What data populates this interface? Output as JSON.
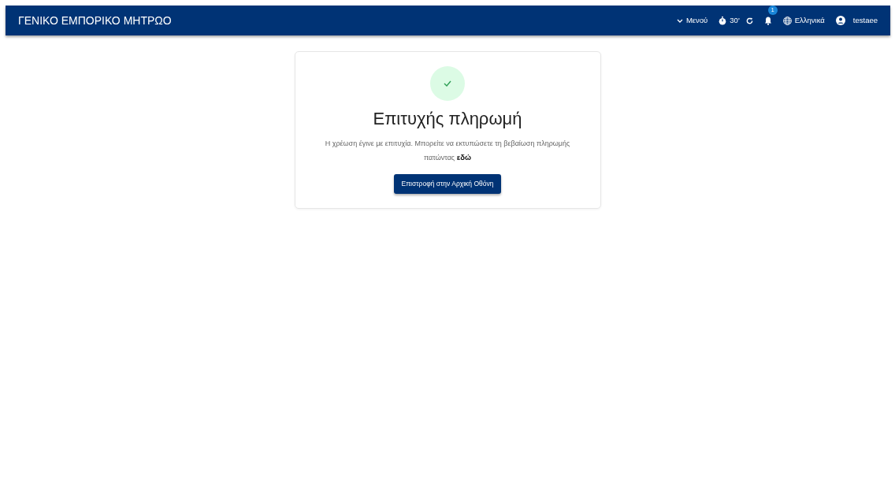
{
  "navbar": {
    "brand": "ΓΕΝΙΚΟ ΕΜΠΟΡΙΚΟ ΜΗΤΡΩΟ",
    "menu": "Μενού",
    "timer": "30'",
    "notifications": "1",
    "language": "Ελληνικά",
    "user": "testaee"
  },
  "card": {
    "title": "Επιτυχής πληρωμή",
    "message": "Η χρέωση έγινε με επιτυχία. Μπορείτε να εκτυπώσετε τη βεβαίωση πληρωμής πατώντας",
    "link": "εδώ",
    "button": "Επιστροφή στην Αρχική Οθόνη"
  }
}
